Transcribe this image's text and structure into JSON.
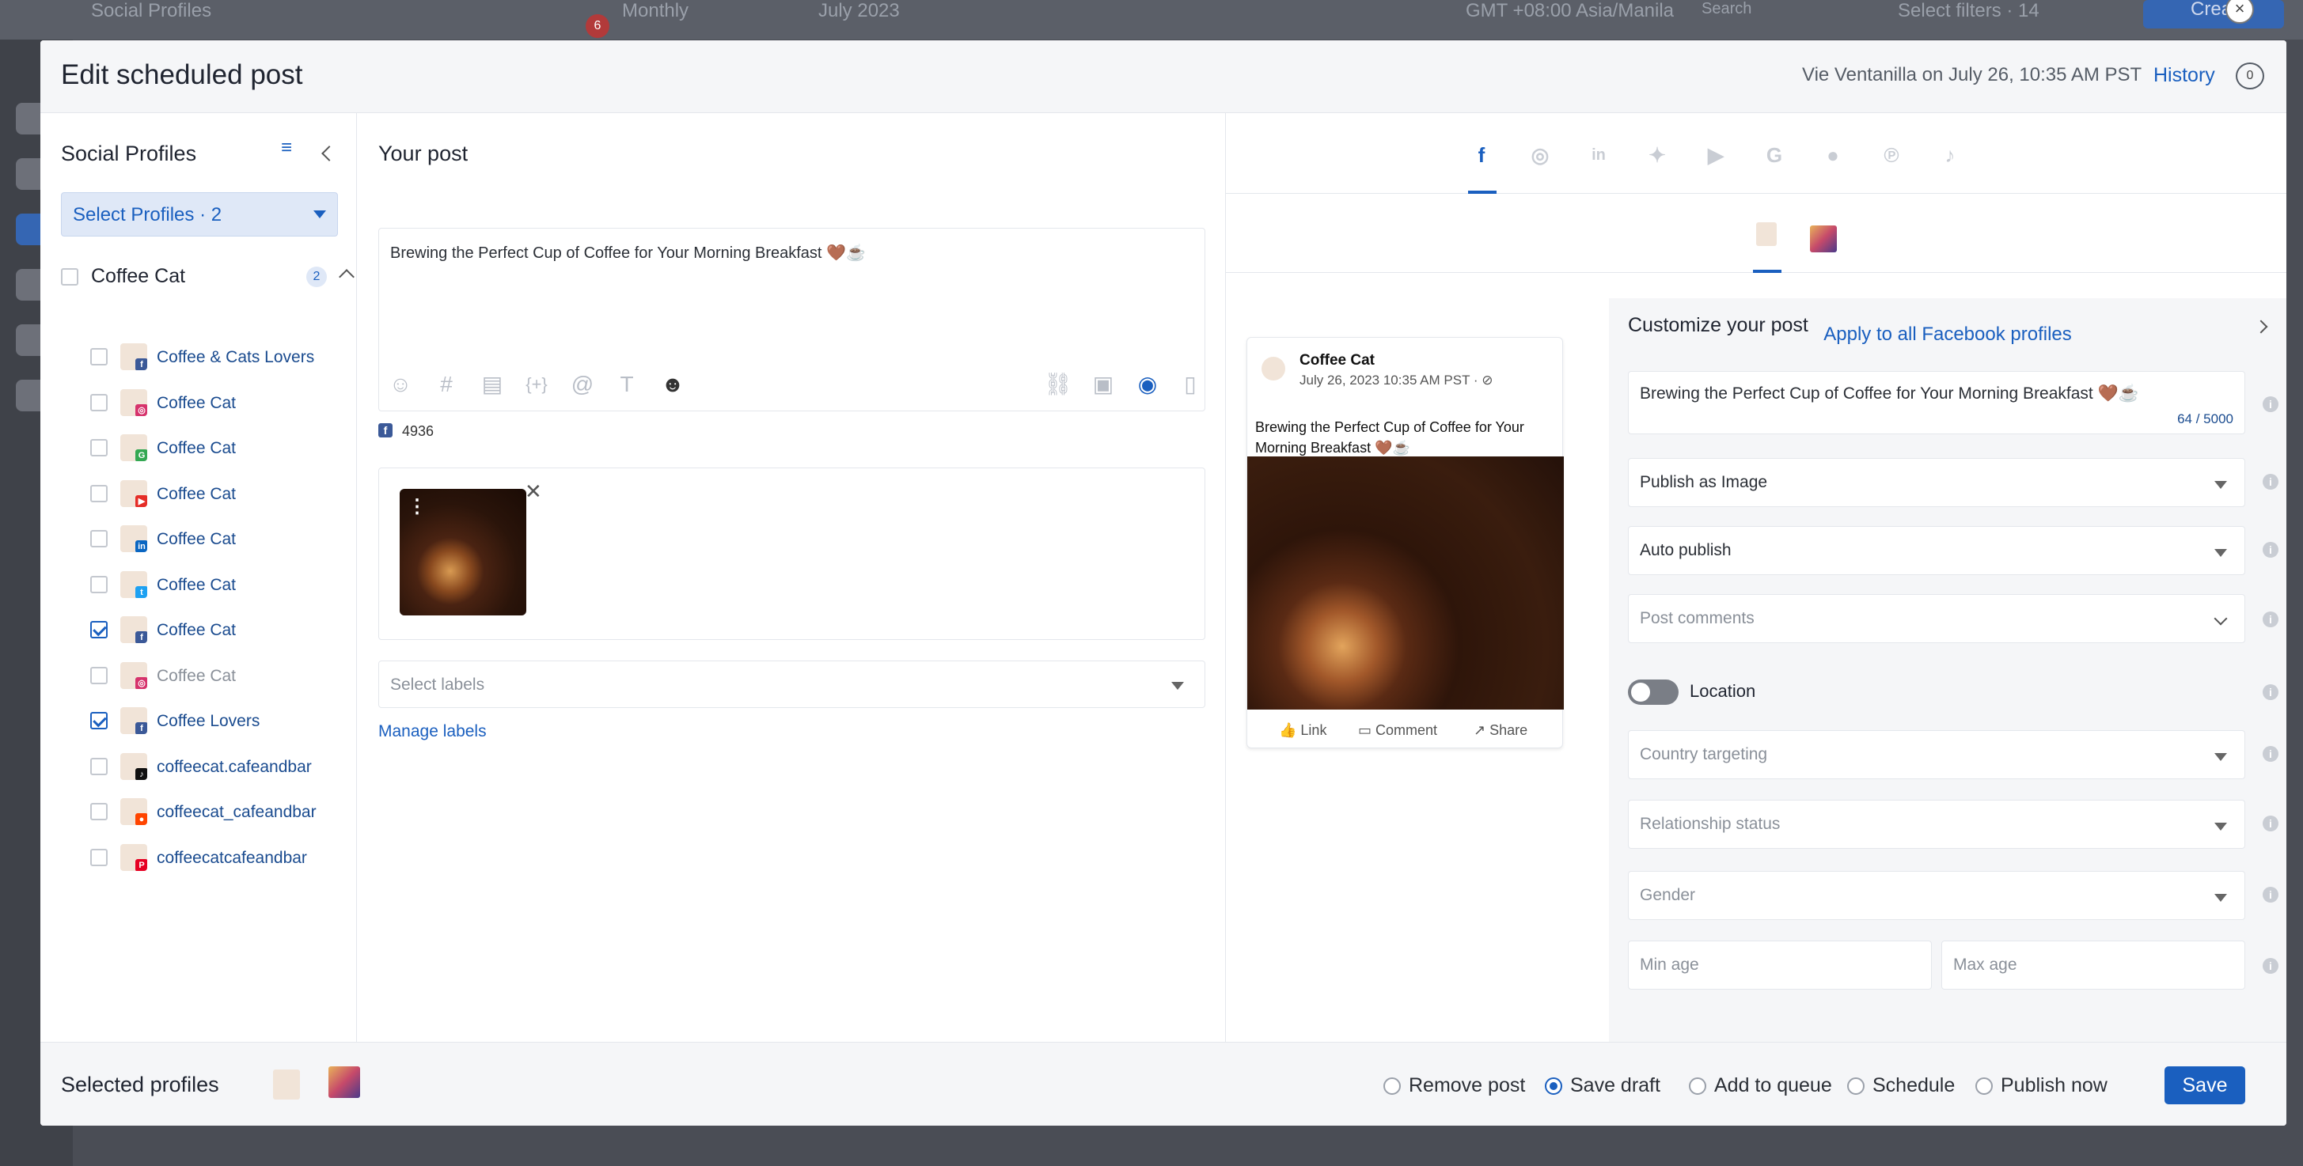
{
  "background": {
    "page_title": "Social Profiles",
    "view": "Monthly",
    "month": "July 2023",
    "notification_count": "6",
    "timezone": "GMT +08:00 Asia/Manila",
    "search_placeholder": "Search",
    "filters": "Select filters · 14",
    "create_label": "Create"
  },
  "modal": {
    "title": "Edit scheduled post",
    "meta": "Vie Ventanilla on July 26, 10:35 AM PST",
    "history_label": "History",
    "comment_count": "0",
    "close": "×"
  },
  "sidebar": {
    "title": "Social Profiles",
    "select_label": "Select Profiles · 2",
    "group": {
      "label": "Coffee Cat",
      "count": "2"
    },
    "profiles": [
      {
        "label": "Coffee & Cats Lovers",
        "network": "facebook",
        "checked": false
      },
      {
        "label": "Coffee Cat",
        "network": "instagram",
        "checked": false
      },
      {
        "label": "Coffee Cat",
        "network": "google",
        "checked": false
      },
      {
        "label": "Coffee Cat",
        "network": "youtube",
        "checked": false
      },
      {
        "label": "Coffee Cat",
        "network": "linkedin",
        "checked": false
      },
      {
        "label": "Coffee Cat",
        "network": "twitter",
        "checked": false
      },
      {
        "label": "Coffee Cat",
        "network": "facebook",
        "checked": true
      },
      {
        "label": "Coffee Cat",
        "network": "instagram",
        "checked": false
      },
      {
        "label": "Coffee Lovers",
        "network": "facebook",
        "checked": true
      },
      {
        "label": "coffeecat.cafeandbar",
        "network": "tiktok",
        "checked": false
      },
      {
        "label": "coffeecat_cafeandbar",
        "network": "reddit",
        "checked": false
      },
      {
        "label": "coffeecatcafeandbar",
        "network": "pinterest",
        "checked": false
      }
    ]
  },
  "post": {
    "title": "Your post",
    "text": "Brewing the Perfect Cup of Coffee for Your Morning Breakfast 🤎☕",
    "fb_count": "4936",
    "labels_placeholder": "Select labels",
    "manage_labels": "Manage labels"
  },
  "preview": {
    "name": "Coffee Cat",
    "date": "July 26, 2023 10:35 AM PST · ⊘",
    "text": "Brewing the Perfect Cup of Coffee for Your Morning Breakfast 🤎☕",
    "actions": [
      "Link",
      "Comment",
      "Share"
    ]
  },
  "customize": {
    "title": "Customize your post",
    "text": "Brewing the Perfect Cup of Coffee for Your Morning Breakfast 🤎☕",
    "char_count": "64 / 5000",
    "publish_as": "Publish as Image",
    "publish_mode": "Auto publish",
    "comments_placeholder": "Post comments",
    "location_label": "Location",
    "country_placeholder": "Country targeting",
    "relationship_placeholder": "Relationship status",
    "gender_placeholder": "Gender",
    "min_age_placeholder": "Min age",
    "max_age_placeholder": "Max age",
    "apply_label": "Apply to all Facebook profiles"
  },
  "footer": {
    "title": "Selected profiles",
    "options": [
      "Remove post",
      "Save draft",
      "Add to queue",
      "Schedule",
      "Publish now"
    ],
    "selected_option": "Save draft",
    "save_label": "Save"
  },
  "colors": {
    "accent": "#1a5fbf",
    "facebook": "#3b5998"
  }
}
